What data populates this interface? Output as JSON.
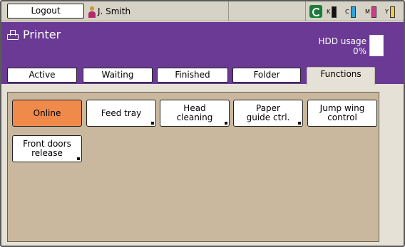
{
  "topbar": {
    "logout_label": "Logout",
    "user_name": "J. Smith",
    "toners": [
      {
        "label": "K",
        "color": "#111111"
      },
      {
        "label": "C",
        "color": "#2aa6e0"
      },
      {
        "label": "M",
        "color": "#d8388a"
      },
      {
        "label": "Y",
        "color": "#f2c94c"
      }
    ]
  },
  "header": {
    "title": "Printer",
    "hdd_label": "HDD usage",
    "hdd_value": "0%"
  },
  "tabs": [
    {
      "label": "Active"
    },
    {
      "label": "Waiting"
    },
    {
      "label": "Finished"
    },
    {
      "label": "Folder"
    },
    {
      "label": "Functions",
      "active": true
    }
  ],
  "functions": {
    "online": "Online",
    "feed_tray": "Feed tray",
    "head_cleaning_1": "Head",
    "head_cleaning_2": "cleaning",
    "paper_guide_1": "Paper",
    "paper_guide_2": "guide ctrl.",
    "jump_wing_1": "Jump wing",
    "jump_wing_2": "control",
    "front_doors_1": "Front doors",
    "front_doors_2": "release"
  },
  "colors": {
    "header_purple": "#6b3a94",
    "online_orange": "#f08a4b",
    "content_tan": "#c9b89d"
  }
}
